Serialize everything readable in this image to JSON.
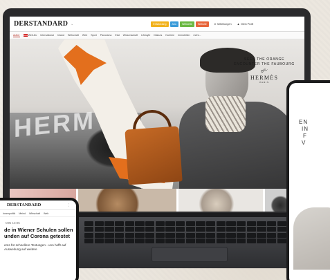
{
  "site": {
    "logo": "DERSTANDARD",
    "logo_menu_icon": "dots-icon",
    "pills": [
      {
        "label": "Entwicklung",
        "color": "#f2b21c"
      },
      {
        "label": "Abo",
        "color": "#3a9bd9"
      },
      {
        "label": "Webseite",
        "color": "#6bb843"
      },
      {
        "label": "Website",
        "color": "#e8653a"
      }
    ],
    "notifications": "Mitteilungen",
    "profile": "Mein Profil",
    "nav": [
      "Aufter",
      "Welt-Dc",
      "International",
      "Inland",
      "Wirtschaft",
      "Web",
      "Sport",
      "Panorama",
      "Etat",
      "Wissenschaft",
      "Lifestyle",
      "Diskurs",
      "Karriere",
      "Immobilien",
      "mehr..."
    ]
  },
  "ad": {
    "slogan_line1": "SEEK THE ORANGE",
    "slogan_line2": "ENCOUNTER THE FAUBOURG",
    "brand": "HERMÈS",
    "brand_city": "PARIS",
    "backdrop_text": "HERM"
  },
  "phone": {
    "logo": "DERSTANDARD",
    "nav": [
      "Innenpolitik",
      "Meind",
      "Wirtschaft",
      "Web"
    ],
    "time": "MIN 13:05",
    "headline": "de in Wiener Schulen sollen unden auf Corona getestet",
    "body": "ems für schnellere Testungen - unn hofft auf Ausweitung auf weitere"
  },
  "phone2": {
    "lines": [
      "EN",
      "IN",
      "F",
      "V"
    ]
  }
}
